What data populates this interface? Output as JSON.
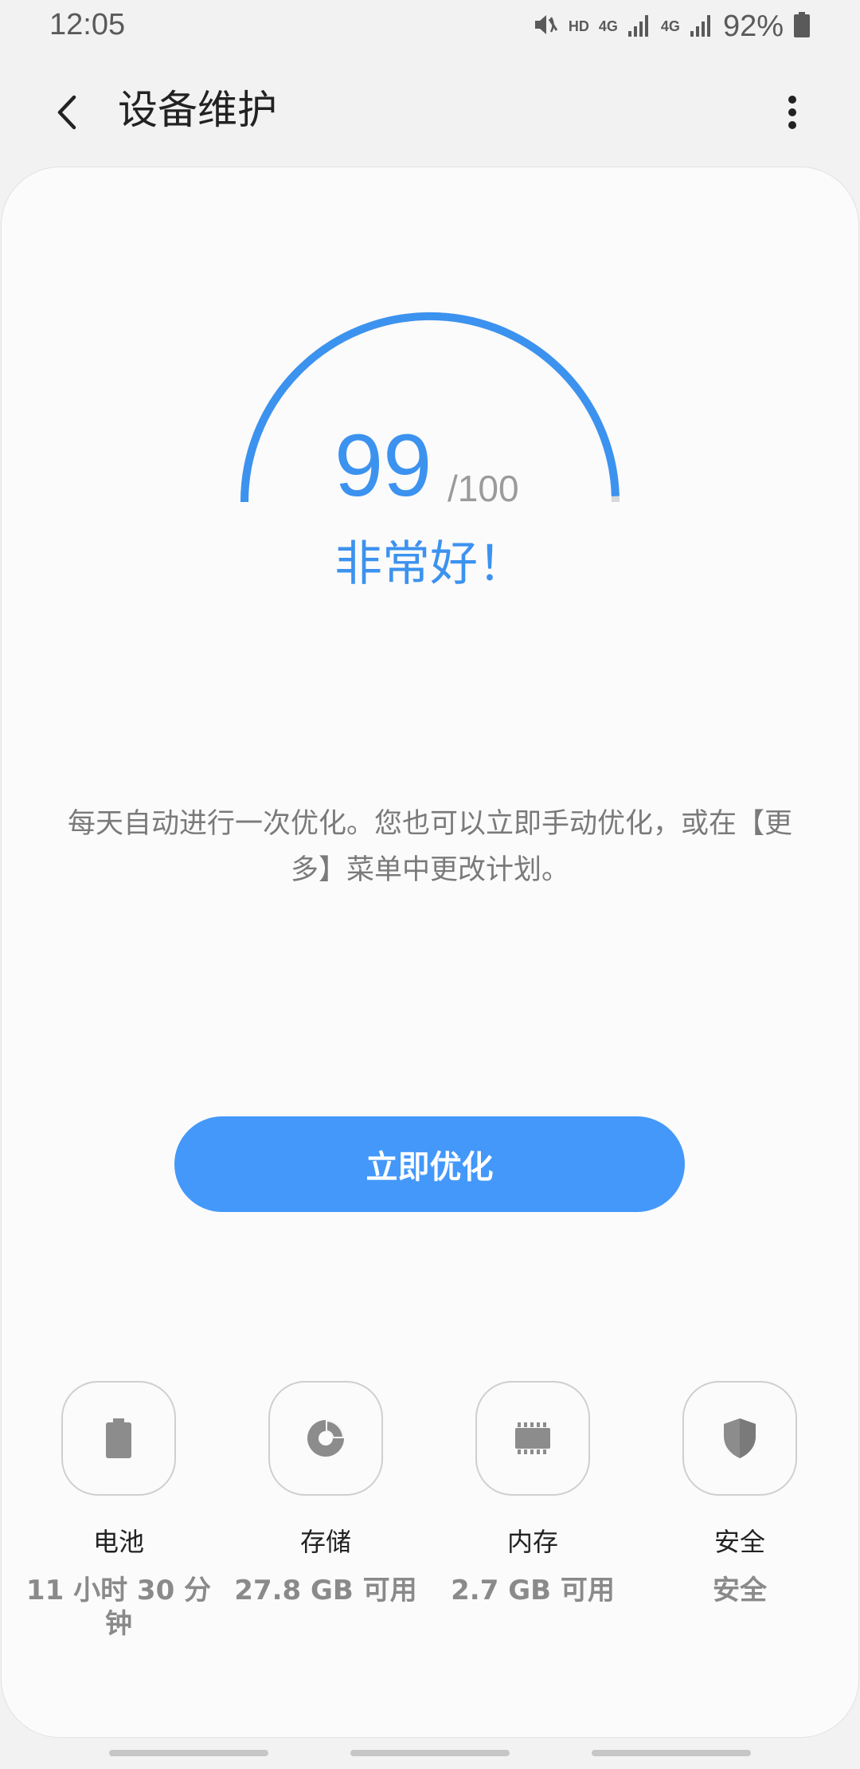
{
  "status_bar": {
    "time": "12:05",
    "hd": "HD",
    "net1": "4G",
    "net2": "4G",
    "battery": "92%",
    "icons": [
      "mute-icon",
      "signal-icon",
      "signal-icon",
      "battery-icon"
    ]
  },
  "app_bar": {
    "title": "设备维护",
    "back_icon": "back-arrow-icon",
    "more_icon": "more-vert-icon"
  },
  "score": {
    "value": "99",
    "max": "/100",
    "status": "非常好！",
    "fraction": 0.99
  },
  "description": "每天自动进行一次优化。您也可以立即手动优化，或在【更多】菜单中更改计划。",
  "optimize_button": "立即优化",
  "tiles": [
    {
      "label": "电池",
      "value": "11 小时 30 分钟",
      "icon": "battery-icon"
    },
    {
      "label": "存储",
      "value": "27.8 GB 可用",
      "icon": "storage-pie-icon"
    },
    {
      "label": "内存",
      "value": "2.7 GB 可用",
      "icon": "memory-chip-icon"
    },
    {
      "label": "安全",
      "value": "安全",
      "icon": "shield-icon"
    }
  ],
  "colors": {
    "accent": "#3c92ef",
    "button": "#4398fa",
    "background": "#f2f2f2",
    "card": "#fbfbfb"
  }
}
